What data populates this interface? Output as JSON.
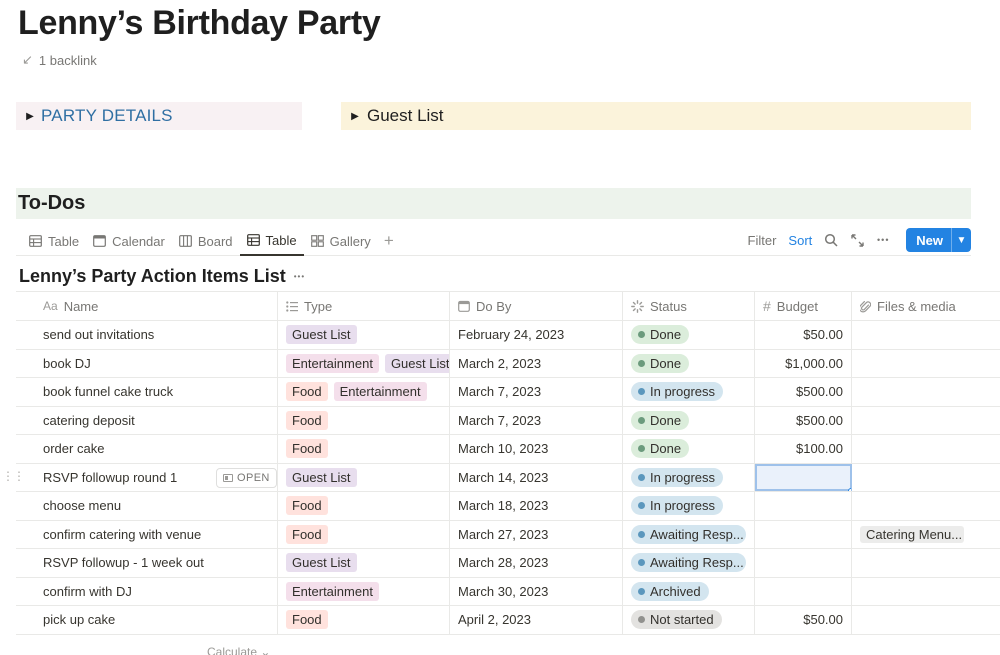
{
  "page": {
    "title": "Lenny’s Birthday Party",
    "backlinks": "1 backlink"
  },
  "toggles": {
    "party_details": "PARTY DETAILS",
    "guest_list": "Guest List"
  },
  "section": {
    "todos": "To-Dos"
  },
  "views": {
    "tabs": [
      {
        "label": "Table",
        "icon": "table-icon"
      },
      {
        "label": "Calendar",
        "icon": "calendar-icon"
      },
      {
        "label": "Board",
        "icon": "board-icon"
      },
      {
        "label": "Table",
        "icon": "table-icon",
        "active": true
      },
      {
        "label": "Gallery",
        "icon": "gallery-icon"
      }
    ],
    "add": "+",
    "filter": "Filter",
    "sort": "Sort",
    "more": "•••",
    "new": "New"
  },
  "database": {
    "title": "Lenny’s Party Action Items List",
    "more": "•••"
  },
  "columns": {
    "name": "Name",
    "name_icon": "Aa",
    "type": "Type",
    "do_by": "Do By",
    "status": "Status",
    "budget": "Budget",
    "files": "Files & media"
  },
  "rows": [
    {
      "name": "send out invitations",
      "types": [
        "Guest List"
      ],
      "date": "February 24, 2023",
      "status": "Done",
      "budget": "$50.00",
      "files": ""
    },
    {
      "name": "book DJ",
      "types": [
        "Entertainment",
        "Guest List"
      ],
      "date": "March 2, 2023",
      "status": "Done",
      "budget": "$1,000.00",
      "files": ""
    },
    {
      "name": "book funnel cake truck",
      "types": [
        "Food",
        "Entertainment"
      ],
      "date": "March 7, 2023",
      "status": "In progress",
      "budget": "$500.00",
      "files": ""
    },
    {
      "name": "catering deposit",
      "types": [
        "Food"
      ],
      "date": "March 7, 2023",
      "status": "Done",
      "budget": "$500.00",
      "files": ""
    },
    {
      "name": "order cake",
      "types": [
        "Food"
      ],
      "date": "March 10, 2023",
      "status": "Done",
      "budget": "$100.00",
      "files": ""
    },
    {
      "name": "RSVP followup round 1",
      "types": [
        "Guest List"
      ],
      "date": "March 14, 2023",
      "status": "In progress",
      "budget": "",
      "files": "",
      "hover": true
    },
    {
      "name": "choose menu",
      "types": [
        "Food"
      ],
      "date": "March 18, 2023",
      "status": "In progress",
      "budget": "",
      "files": ""
    },
    {
      "name": "confirm catering with venue",
      "types": [
        "Food"
      ],
      "date": "March 27, 2023",
      "status": "Awaiting Resp...",
      "budget": "",
      "files": "Catering Menu..."
    },
    {
      "name": "RSVP followup - 1 week out",
      "types": [
        "Guest List"
      ],
      "date": "March 28, 2023",
      "status": "Awaiting Resp...",
      "budget": "",
      "files": ""
    },
    {
      "name": "confirm with DJ",
      "types": [
        "Entertainment"
      ],
      "date": "March 30, 2023",
      "status": "Archived",
      "budget": "",
      "files": ""
    },
    {
      "name": "pick up cake",
      "types": [
        "Food"
      ],
      "date": "April 2, 2023",
      "status": "Not started",
      "budget": "$50.00",
      "files": ""
    }
  ],
  "row_open": "OPEN",
  "tag_colors": {
    "Guest List": "#e8deee",
    "Entertainment": "#f4dfeb",
    "Food": "#ffe2dd"
  },
  "status_colors": {
    "Done": {
      "bg": "#dbeddb",
      "dot": "#6c9b7d"
    },
    "In progress": {
      "bg": "#d3e5ef",
      "dot": "#5b97bd"
    },
    "Awaiting Resp...": {
      "bg": "#d3e5ef",
      "dot": "#5b97bd"
    },
    "Archived": {
      "bg": "#d3e5ef",
      "dot": "#5b97bd"
    },
    "Not started": {
      "bg": "#e3e2e0",
      "dot": "#91918e"
    }
  },
  "footer": {
    "calculate": "Calculate ⌄"
  }
}
